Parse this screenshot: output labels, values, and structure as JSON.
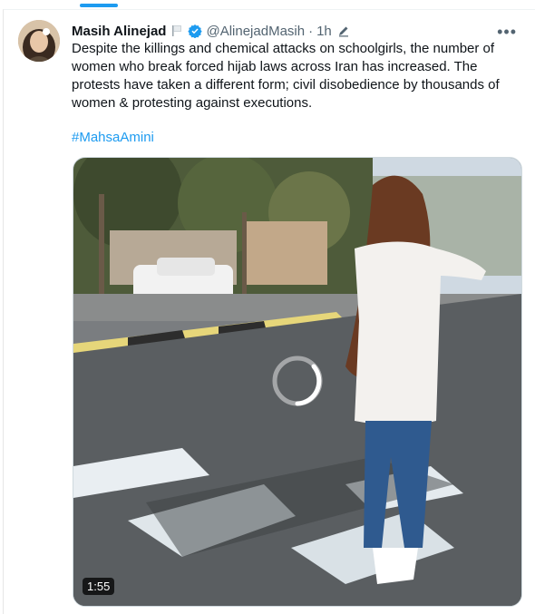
{
  "tweet": {
    "author_name": "Masih Alinejad",
    "handle": "@AlinejadMasih",
    "separator": "·",
    "time": "1h",
    "text": "Despite the killings and chemical attacks on schoolgirls, the number of women who break forced hijab laws across Iran has increased. The protests have taken a different form; civil disobedience by thousands of women & protesting against executions.",
    "hashtag": "#MahsaAmini",
    "more_icon": "more-horizontal-icon",
    "verified_icon": "verified-badge-icon",
    "flag_icon": "flag-icon",
    "edit_icon": "pen-icon"
  },
  "media": {
    "type": "video",
    "duration": "1:55",
    "loading": true
  },
  "colors": {
    "accent": "#1d9bf0",
    "text": "#0f1419",
    "muted": "#536471"
  }
}
